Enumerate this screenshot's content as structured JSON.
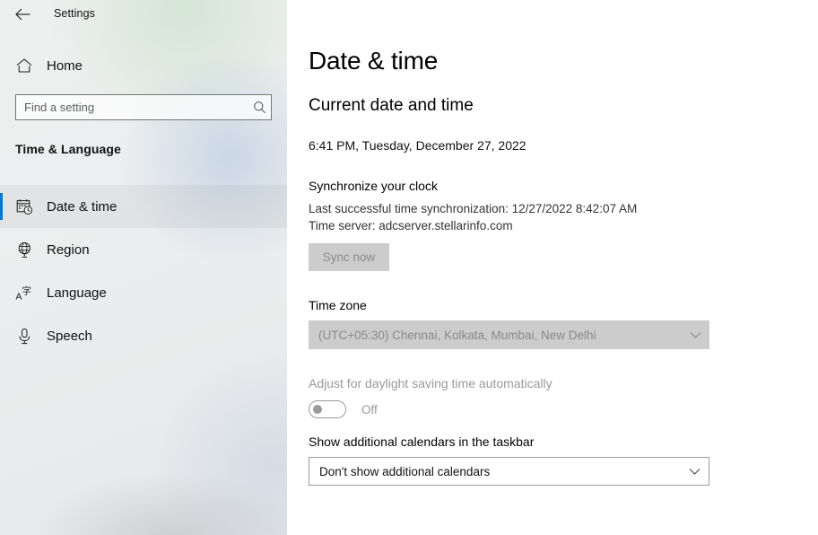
{
  "window": {
    "app_title": "Settings",
    "back_icon": "back-arrow-icon"
  },
  "sidebar": {
    "home_label": "Home",
    "home_icon": "home-icon",
    "search": {
      "placeholder": "Find a setting",
      "value": "",
      "icon": "search-icon"
    },
    "section_title": "Time & Language",
    "items": [
      {
        "label": "Date & time",
        "icon": "calendar-clock-icon",
        "selected": true
      },
      {
        "label": "Region",
        "icon": "globe-icon",
        "selected": false
      },
      {
        "label": "Language",
        "icon": "language-icon",
        "selected": false
      },
      {
        "label": "Speech",
        "icon": "microphone-icon",
        "selected": false
      }
    ],
    "accent_color": "#0078d7"
  },
  "main": {
    "page_title": "Date & time",
    "current_section": {
      "heading": "Current date and time",
      "value": "6:41 PM, Tuesday, December 27, 2022"
    },
    "synchronize": {
      "heading": "Synchronize your clock",
      "last_sync": "Last successful time synchronization: 12/27/2022 8:42:07 AM",
      "time_server": "Time server: adcserver.stellarinfo.com",
      "sync_button_label": "Sync now",
      "sync_button_disabled": true
    },
    "time_zone": {
      "label": "Time zone",
      "selected": "(UTC+05:30) Chennai, Kolkata, Mumbai, New Delhi",
      "disabled": true,
      "chevron_icon": "chevron-down-icon"
    },
    "daylight_saving": {
      "label": "Adjust for daylight saving time automatically",
      "state": "Off",
      "checked": false,
      "disabled": true
    },
    "additional_calendars": {
      "label": "Show additional calendars in the taskbar",
      "selected": "Don't show additional calendars",
      "disabled": false,
      "chevron_icon": "chevron-down-icon"
    }
  }
}
